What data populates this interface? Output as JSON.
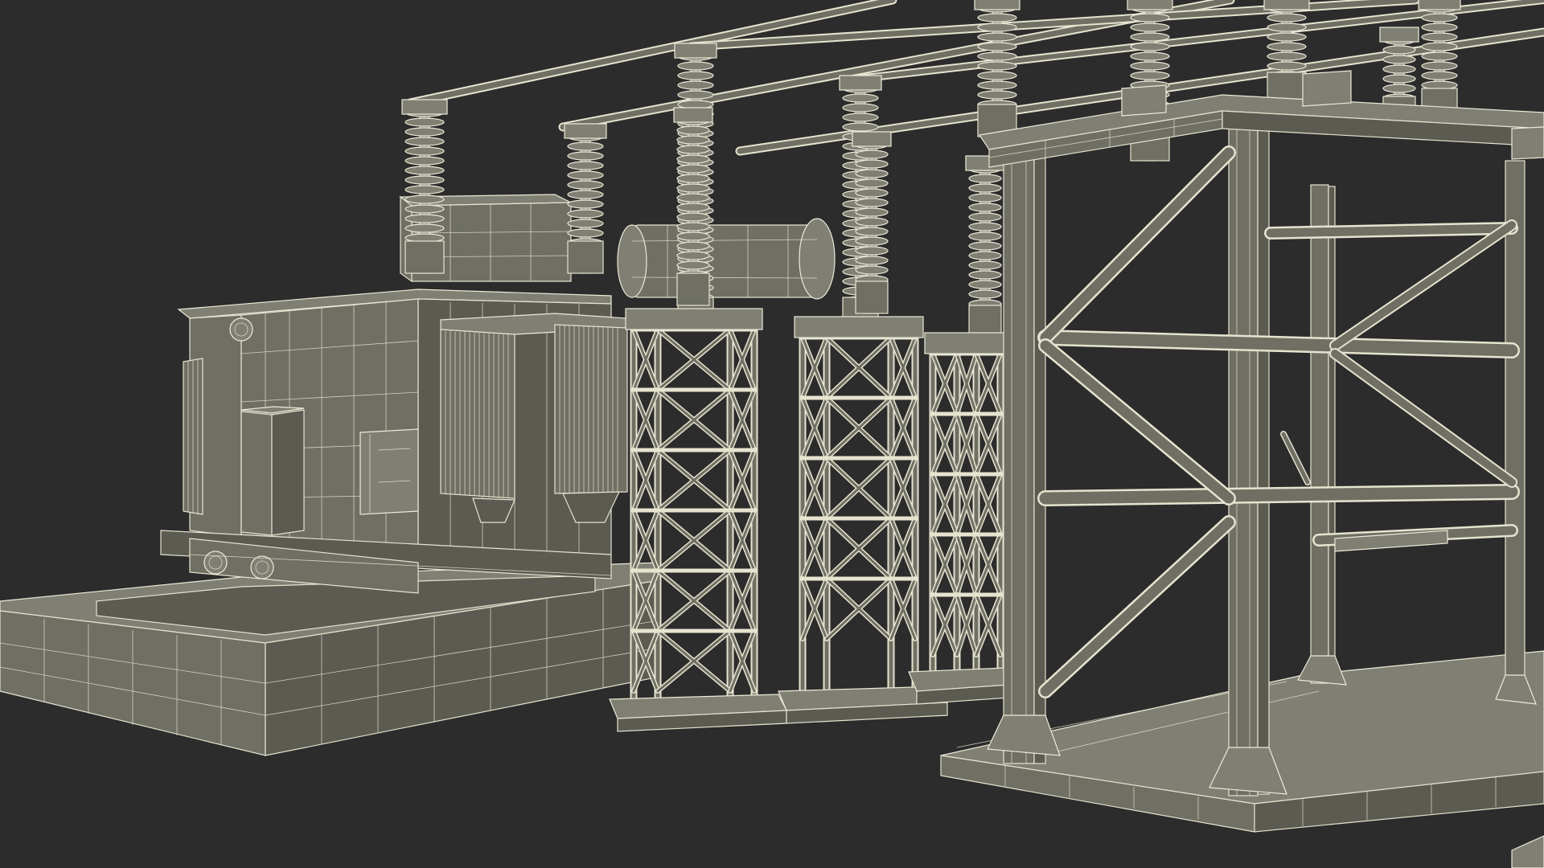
{
  "scene": {
    "subject": "substation",
    "background_color": "#2c2c2c",
    "wire_color": "#e6e3cf",
    "surface_color": "#6f6f64"
  }
}
